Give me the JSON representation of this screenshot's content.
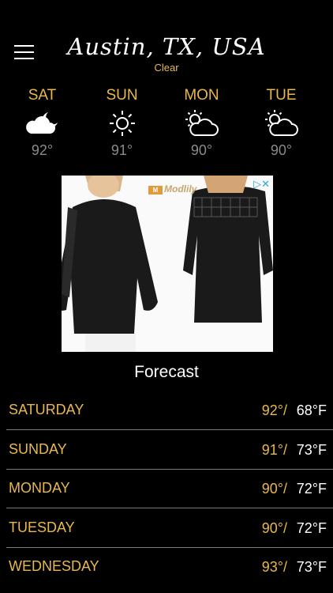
{
  "header": {
    "city": "Austin, TX, USA",
    "condition": "Clear"
  },
  "days": [
    {
      "name": "SAT",
      "icon": "partly-cloudy-night-icon",
      "temp": "92°"
    },
    {
      "name": "SUN",
      "icon": "sun-icon",
      "temp": "91°"
    },
    {
      "name": "MON",
      "icon": "partly-cloudy-day-icon",
      "temp": "90°"
    },
    {
      "name": "TUE",
      "icon": "partly-cloudy-day-icon",
      "temp": "90°"
    }
  ],
  "ad": {
    "brand": "Modlily"
  },
  "forecast": {
    "title": "Forecast",
    "rows": [
      {
        "day": "SATURDAY",
        "hi": "92°/",
        "lo": "68°F"
      },
      {
        "day": "SUNDAY",
        "hi": "91°/",
        "lo": "73°F"
      },
      {
        "day": "MONDAY",
        "hi": "90°/",
        "lo": "72°F"
      },
      {
        "day": "TUESDAY",
        "hi": "90°/",
        "lo": "72°F"
      },
      {
        "day": "WEDNESDAY",
        "hi": "93°/",
        "lo": "73°F"
      }
    ]
  },
  "colors": {
    "background": "#000000",
    "accent": "#e8b84c",
    "muted": "#8a8a8a"
  }
}
